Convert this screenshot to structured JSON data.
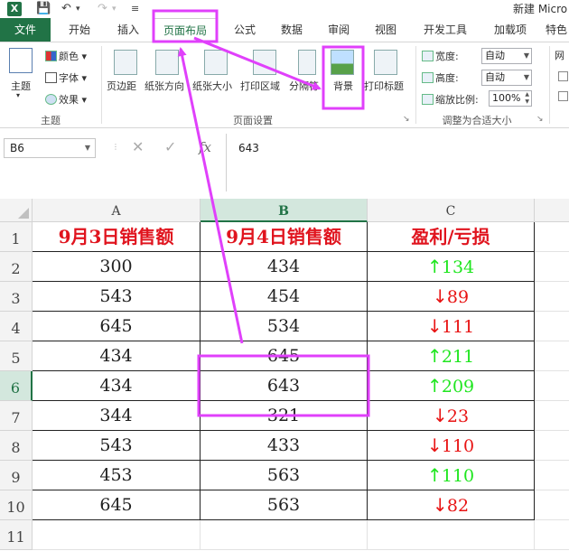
{
  "window": {
    "title": "新建 Micro"
  },
  "quick_access": {
    "save_icon": "save-icon",
    "undo_icon": "undo-icon",
    "redo_icon": "redo-icon"
  },
  "tabs": [
    {
      "label": "文件"
    },
    {
      "label": "开始"
    },
    {
      "label": "插入"
    },
    {
      "label": "页面布局"
    },
    {
      "label": "公式"
    },
    {
      "label": "数据"
    },
    {
      "label": "审阅"
    },
    {
      "label": "视图"
    },
    {
      "label": "开发工具"
    },
    {
      "label": "加载项"
    },
    {
      "label": "特色"
    }
  ],
  "ribbon": {
    "theme_group": {
      "label": "主题",
      "themes_button": "主题",
      "colors": "颜色",
      "fonts": "字体",
      "effects": "效果"
    },
    "page_setup_group": {
      "label": "页面设置",
      "margins": "页边距",
      "orientation": "纸张方向",
      "size": "纸张大小",
      "print_area": "打印区域",
      "breaks": "分隔符",
      "background": "背景",
      "print_titles": "打印标题"
    },
    "scale_group": {
      "label": "调整为合适大小",
      "width_label": "宽度:",
      "width_value": "自动",
      "height_label": "高度:",
      "height_value": "自动",
      "scale_label": "缩放比例:",
      "scale_value": "100%"
    },
    "sheet_options_cut": "网"
  },
  "formula_bar": {
    "name_box": "B6",
    "cancel_icon": "✕",
    "enter_icon": "✓",
    "fx_label": "fx",
    "value": "643"
  },
  "grid": {
    "columns": [
      "A",
      "B",
      "C"
    ],
    "rows": [
      "1",
      "2",
      "3",
      "4",
      "5",
      "6",
      "7",
      "8",
      "9",
      "10",
      "11"
    ],
    "header": [
      "9月3日销售额",
      "9月4日销售额",
      "盈利/亏损"
    ],
    "data": [
      {
        "a": "300",
        "b": "434",
        "arrow": "↑",
        "c": "134",
        "trend": "up"
      },
      {
        "a": "543",
        "b": "454",
        "arrow": "↓",
        "c": "89",
        "trend": "down"
      },
      {
        "a": "645",
        "b": "534",
        "arrow": "↓",
        "c": "111",
        "trend": "down"
      },
      {
        "a": "434",
        "b": "645",
        "arrow": "↑",
        "c": "211",
        "trend": "up"
      },
      {
        "a": "434",
        "b": "643",
        "arrow": "↑",
        "c": "209",
        "trend": "up"
      },
      {
        "a": "344",
        "b": "321",
        "arrow": "↓",
        "c": "23",
        "trend": "down"
      },
      {
        "a": "543",
        "b": "433",
        "arrow": "↓",
        "c": "110",
        "trend": "down"
      },
      {
        "a": "453",
        "b": "563",
        "arrow": "↑",
        "c": "110",
        "trend": "up"
      },
      {
        "a": "645",
        "b": "563",
        "arrow": "↓",
        "c": "82",
        "trend": "down"
      }
    ],
    "selected_cell": "B6"
  },
  "colors": {
    "accent": "#217346",
    "annotation": "#e040fb",
    "header_text": "#e0141e",
    "up": "#1fe61f",
    "down": "#e81414"
  }
}
